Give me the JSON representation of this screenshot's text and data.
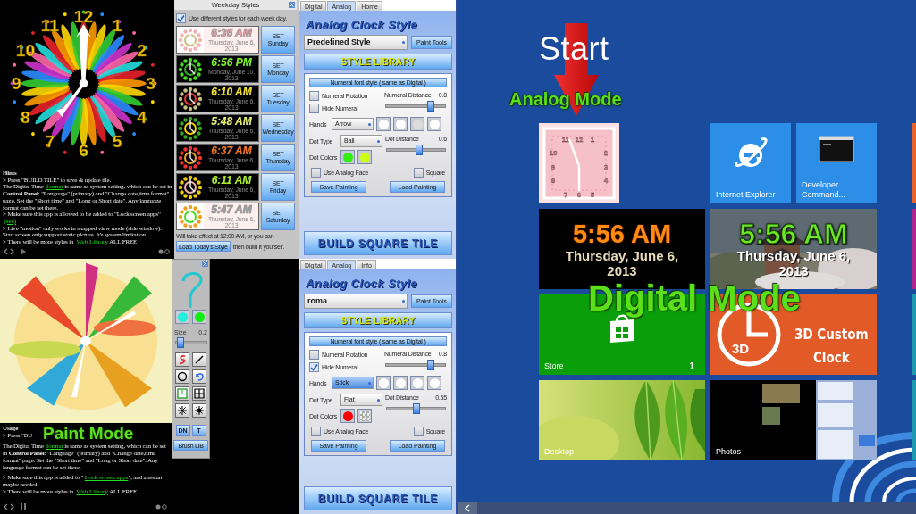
{
  "app": {
    "clock_preview": {
      "numerals": [
        "12",
        "1",
        "2",
        "3",
        "4",
        "5",
        "6",
        "7",
        "8",
        "9",
        "10",
        "11"
      ]
    },
    "hints": {
      "title": "Hints",
      "paragraphs": [
        [
          {
            "kind": "plain",
            "text": "> Press \"BUILD TILE\" to save & update tile."
          }
        ],
        [
          {
            "kind": "plain",
            "text": "The Digital Time "
          },
          {
            "kind": "link",
            "text": "format"
          },
          {
            "kind": "plain",
            "text": " is same as system setting, which can be set in "
          },
          {
            "kind": "bold",
            "text": "Control Panel"
          },
          {
            "kind": "plain",
            "text": ": \"Language\" (primary) and \"Change date,time format\" page. Set the \"Short time\" and \"Long or Short date\". Any language format can be set there."
          }
        ],
        [
          {
            "kind": "plain",
            "text": "> Make sure this app is allowed to be added to \"Lock screen apps\""
          },
          {
            "kind": "link",
            "text": "(see)"
          }
        ],
        [
          {
            "kind": "plain",
            "text": "> Live \"motion\" only works in snapped view mode (side window). Start screen only support static picture. It's system limitation."
          }
        ],
        [
          {
            "kind": "plain",
            "text": "> There will be more styles in "
          },
          {
            "kind": "link",
            "text": "Web Library"
          },
          {
            "kind": "plain",
            "text": " ALL FREE"
          }
        ]
      ]
    },
    "weekday_styles": {
      "title": "Weekday Styles",
      "use_different": {
        "label": "Use different styles for each week day.",
        "checked": true
      },
      "days": [
        {
          "kind": "light",
          "color": "#e89ca4",
          "time": "6:36 AM",
          "date": "Thursday, June 6, 2013",
          "set": "SET",
          "day": "Sunday"
        },
        {
          "kind": "dark",
          "color": "#77ee22",
          "time": "6:56 PM",
          "date": "Monday, June 10, 2013",
          "set": "SET",
          "day": "Monday"
        },
        {
          "kind": "dark",
          "color": "#f2e030",
          "time": "6:10 AM",
          "date": "Thursday, June 6, 2013",
          "set": "SET",
          "day": "Tuesday"
        },
        {
          "kind": "dark",
          "color": "#e6ee70",
          "time": "5:48 AM",
          "date": "Thursday, June 6, 2013",
          "set": "SET",
          "day": "Wednesday"
        },
        {
          "kind": "dark",
          "color": "#f07020",
          "time": "6:37 AM",
          "date": "Thursday, June 6, 2013",
          "set": "SET",
          "day": "Thursday"
        },
        {
          "kind": "dark",
          "color": "#a8f020",
          "time": "6:11 AM",
          "date": "Thursday, June 6, 2013",
          "set": "SET",
          "day": "Friday"
        },
        {
          "kind": "light",
          "color": "#a0a0a0",
          "time": "5:47 AM",
          "date": "Thursday, June 6, 2013",
          "set": "SET",
          "day": "Saturday"
        }
      ],
      "note": "Will take effect at 12:00 AM, or you can",
      "load_button": "Load Today's Style",
      "note_after": "then build it yourself."
    },
    "analog_panels": [
      {
        "tabs": [
          {
            "label": "Digital",
            "selected": false
          },
          {
            "label": "Analog",
            "selected": true
          },
          {
            "label": "Home",
            "selected": false
          }
        ],
        "title": "Analog Clock Style",
        "style_value": "Predefined Style",
        "paint_tools_button": "Paint Tools",
        "library_button": "STYLE LIBRARY",
        "numeral_font_button": "Numeral font style ( same as Digital )",
        "numeral_rotation": {
          "label": "Numeral Rotation",
          "checked": false
        },
        "hide_numeral": {
          "label": "Hide Numeral",
          "checked": false
        },
        "numeral_distance": {
          "label": "Numeral Distance",
          "reading": "0.8",
          "level": 0.75
        },
        "hands": {
          "label": "Hands",
          "value": "Arrow",
          "focused": false,
          "colors": [
            {
              "color": "#ffffff"
            },
            {
              "color": "#ffffff"
            },
            {
              "color": "#dcdcdc"
            },
            {
              "color": "#ffffff"
            }
          ]
        },
        "dot_type": {
          "label": "Dot Type",
          "value": "Ball"
        },
        "dot_distance": {
          "label": "Dot Distance",
          "reading": "0.6",
          "level": 0.55
        },
        "dot_colors": {
          "label": "Dot Colors",
          "swatches": [
            {
              "kind": "solid",
              "color": "#33ee11"
            },
            {
              "kind": "solid",
              "color": "#ccff11"
            }
          ]
        },
        "use_analog_face": {
          "label": "Use Analog Face",
          "checked": false
        },
        "square": {
          "label": "Square",
          "checked": false
        },
        "save_button": "Save Painting",
        "load_button": "Load Painting",
        "build_button": "BUILD SQUARE TILE"
      },
      {
        "tabs": [
          {
            "label": "Digital",
            "selected": false
          },
          {
            "label": "Analog",
            "selected": true
          },
          {
            "label": "Info",
            "selected": false
          }
        ],
        "title": "Analog Clock Style",
        "style_value": "roma",
        "paint_tools_button": "Paint Tools",
        "library_button": "STYLE LIBRARY",
        "numeral_font_button": "Numeral font style ( same as Digital )",
        "numeral_rotation": {
          "label": "Numeral Rotation",
          "checked": false
        },
        "hide_numeral": {
          "label": "Hide Numeral",
          "checked": true
        },
        "numeral_distance": {
          "label": "Numeral Distance",
          "reading": "0.8",
          "level": 0.75
        },
        "hands": {
          "label": "Hands",
          "value": "Stick",
          "focused": true,
          "colors": [
            {
              "color": "#ffffff"
            },
            {
              "color": "#ffffff"
            },
            {
              "color": "#ffffff"
            },
            {
              "color": "#ffffff"
            }
          ]
        },
        "dot_type": {
          "label": "Dot Type",
          "value": "Flat"
        },
        "dot_distance": {
          "label": "Dot Distance",
          "reading": "0.55",
          "level": 0.5
        },
        "dot_colors": {
          "label": "Dot Colors",
          "swatches": [
            {
              "kind": "solid",
              "color": "#ff0000"
            },
            {
              "kind": "transparent"
            }
          ]
        },
        "use_analog_face": {
          "label": "Use Analog Face",
          "checked": false
        },
        "square": {
          "label": "Square",
          "checked": false
        },
        "save_button": "Save Painting",
        "load_button": "Load Painting",
        "build_button": "BUILD SQUARE TILE"
      }
    ],
    "paint_tools": {
      "swatches": [
        {
          "color": "#22eedd"
        },
        {
          "color": "#11ee11"
        }
      ],
      "size": {
        "label": "Size",
        "reading": "0.2",
        "level": 0.15
      },
      "tools": [
        {
          "kind": "brush"
        },
        {
          "kind": "line"
        },
        {
          "kind": "circle"
        },
        {
          "kind": "undo"
        },
        {
          "kind": "frame"
        },
        {
          "kind": "grid"
        },
        {
          "kind": "star"
        },
        {
          "kind": "burst"
        }
      ],
      "buttons": [
        "DN",
        "T"
      ],
      "brush_lib": "Brush LIB"
    },
    "usage": {
      "title": "Usage",
      "paragraphs": [
        [
          {
            "kind": "plain",
            "text": "> Press \"BU"
          }
        ],
        [
          {
            "kind": "plain",
            "text": "The Digital Time "
          },
          {
            "kind": "link",
            "text": "format"
          },
          {
            "kind": "plain",
            "text": " is same as system setting, which can be set in "
          },
          {
            "kind": "bold",
            "text": "Control Panel"
          },
          {
            "kind": "plain",
            "text": ": \"Language\" (primary) and \"Change date,time format\" page. Set the \"Short time\" and \"Long or Short date\". Any language format can be set there."
          }
        ],
        [
          {
            "kind": "plain",
            "text": "> Make sure this app is added to \""
          },
          {
            "kind": "link",
            "text": "Lock screen apps"
          },
          {
            "kind": "plain",
            "text": "\", and a restart maybe needed."
          }
        ],
        [
          {
            "kind": "plain",
            "text": "> There will be more styles in "
          },
          {
            "kind": "link",
            "text": "Web Library"
          },
          {
            "kind": "plain",
            "text": " ALL FREE"
          }
        ]
      ]
    }
  },
  "start_screen": {
    "title": "Start",
    "tiles": [
      {
        "kind": "analog_clock",
        "numerals": [
          "11",
          "12",
          "1",
          "10",
          "2",
          "9",
          "3",
          "8",
          "4",
          "7",
          "6",
          "5"
        ]
      },
      {
        "kind": "app",
        "label": "Internet Explorer"
      },
      {
        "kind": "app",
        "label": "Developer Command..."
      },
      {
        "kind": "digital_dark",
        "time": "5:56 AM",
        "date": "Thursday, June 6, 2013"
      },
      {
        "kind": "digital_photo",
        "time": "5:56 AM",
        "date": "Thursday, June 6, 2013"
      },
      {
        "kind": "store",
        "label": "Store",
        "badge": "1"
      },
      {
        "kind": "custom_clock",
        "icon_text": "3D",
        "title": "3D Custom",
        "subtitle": "Clock"
      },
      {
        "kind": "desktop",
        "label": "Desktop"
      },
      {
        "kind": "photos",
        "label": "Photos"
      }
    ]
  },
  "annotations": [
    {
      "kind": "analog",
      "text": "Analog Mode"
    },
    {
      "kind": "digital",
      "text": "Digital Mode"
    },
    {
      "kind": "paint",
      "text": "Paint Mode"
    }
  ]
}
